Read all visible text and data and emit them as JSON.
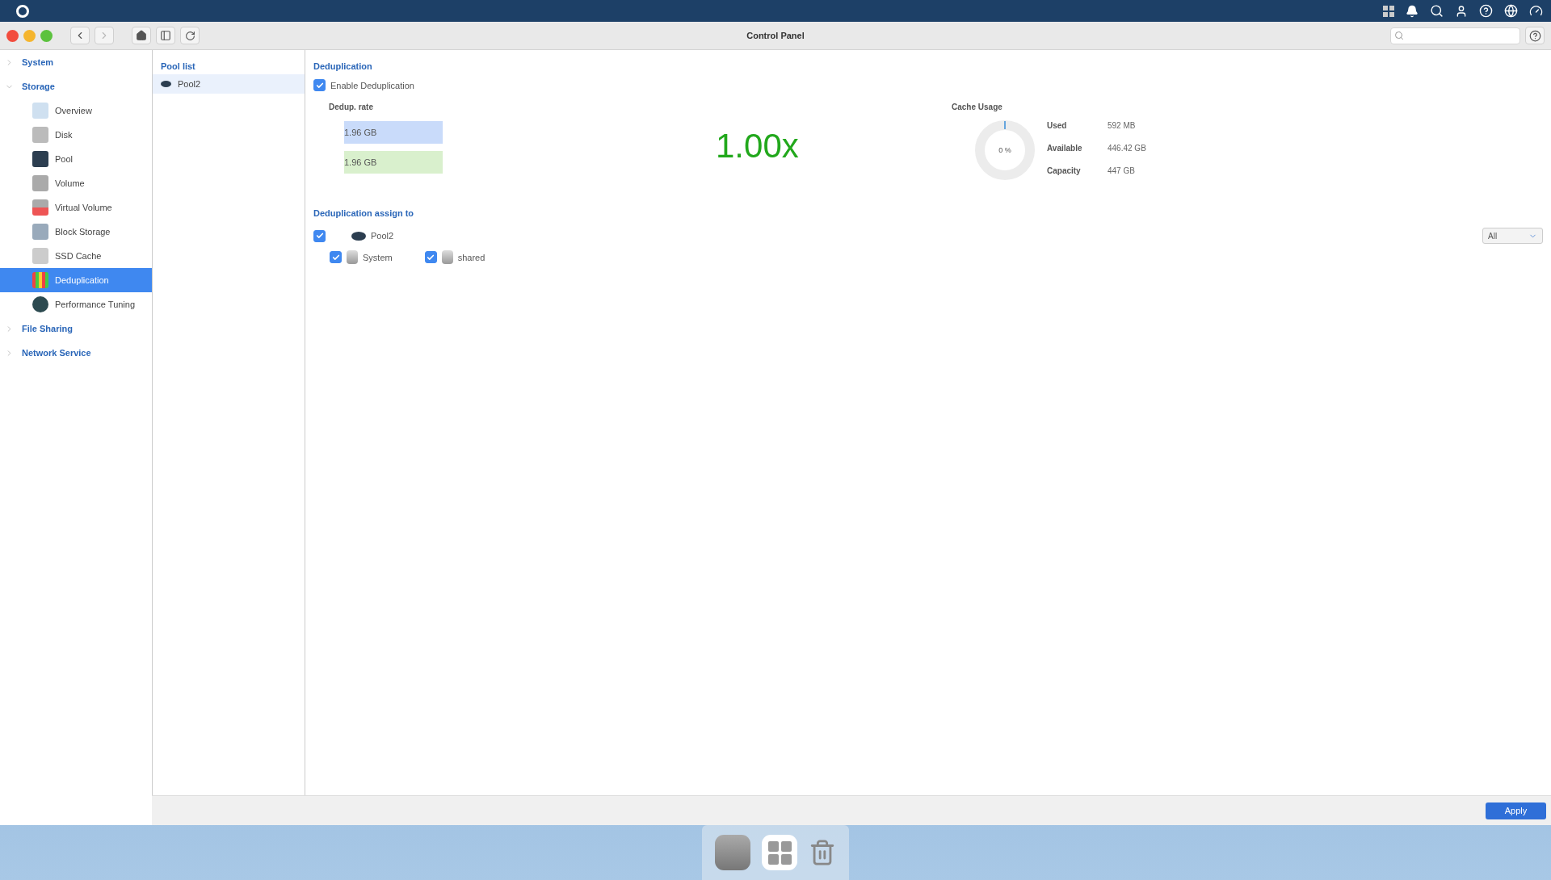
{
  "window": {
    "title": "Control Panel"
  },
  "sidebar": {
    "items": [
      {
        "label": "System",
        "expanded": false
      },
      {
        "label": "Storage",
        "expanded": true,
        "children": [
          {
            "label": "Overview",
            "selected": false
          },
          {
            "label": "Disk",
            "selected": false
          },
          {
            "label": "Pool",
            "selected": false
          },
          {
            "label": "Volume",
            "selected": false
          },
          {
            "label": "Virtual Volume",
            "selected": false
          },
          {
            "label": "Block Storage",
            "selected": false
          },
          {
            "label": "SSD Cache",
            "selected": false
          },
          {
            "label": "Deduplication",
            "selected": true
          },
          {
            "label": "Performance Tuning",
            "selected": false
          }
        ]
      },
      {
        "label": "File Sharing",
        "expanded": false
      },
      {
        "label": "Network Service",
        "expanded": false
      }
    ]
  },
  "pool_list": {
    "title": "Pool list",
    "items": [
      {
        "label": "Pool2",
        "selected": true
      }
    ]
  },
  "deduplication": {
    "title": "Deduplication",
    "enable": {
      "label": "Enable Deduplication",
      "checked": true
    },
    "rate": {
      "title": "Dedup. rate",
      "bars": [
        {
          "value": "1.96 GB",
          "color": "#c9dbfa"
        },
        {
          "value": "1.96 GB",
          "color": "#d9f0cd"
        }
      ],
      "ratio": "1.00x"
    },
    "cache": {
      "title": "Cache Usage",
      "percent": "0 %",
      "stats": [
        {
          "label": "Used",
          "value": "592 MB"
        },
        {
          "label": "Available",
          "value": "446.42 GB"
        },
        {
          "label": "Capacity",
          "value": "447 GB"
        }
      ]
    }
  },
  "assign": {
    "title": "Deduplication assign to",
    "pool": {
      "label": "Pool2",
      "checked": true
    },
    "volumes": [
      {
        "label": "System",
        "checked": true
      },
      {
        "label": "shared",
        "checked": true
      }
    ],
    "filter": "All"
  },
  "footer": {
    "apply": "Apply"
  }
}
